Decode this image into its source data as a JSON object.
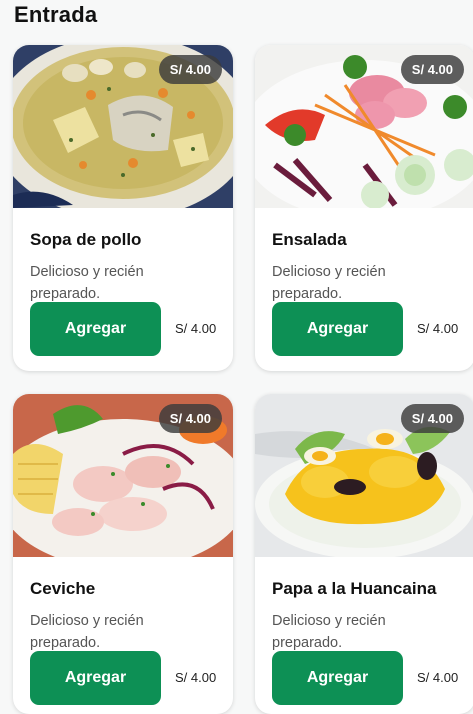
{
  "section": {
    "title": "Entrada"
  },
  "items": [
    {
      "name": "Sopa de pollo",
      "description": "Delicioso y recién preparado.",
      "badge": "S/ 4.00",
      "price": "S/ 4.00",
      "button": "Agregar"
    },
    {
      "name": "Ensalada",
      "description": "Delicioso y recién preparado.",
      "badge": "S/ 4.00",
      "price": "S/ 4.00",
      "button": "Agregar"
    },
    {
      "name": "Ceviche",
      "description": "Delicioso y recién preparado.",
      "badge": "S/ 4.00",
      "price": "S/ 4.00",
      "button": "Agregar"
    },
    {
      "name": "Papa a la Huancaina",
      "description": "Delicioso y recién preparado.",
      "badge": "S/ 4.00",
      "price": "S/ 4.00",
      "button": "Agregar"
    }
  ],
  "colors": {
    "accent": "#0d9055",
    "badge_bg": "#3c3c3c"
  }
}
